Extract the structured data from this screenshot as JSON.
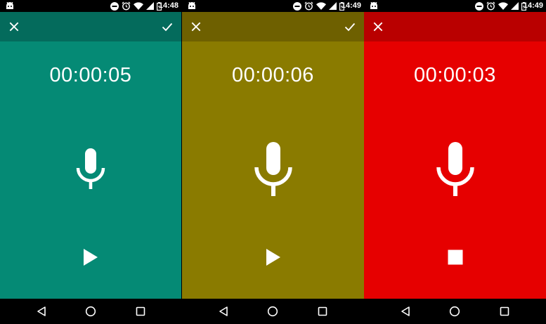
{
  "screens": [
    {
      "time": "14:48",
      "timer": "00:00:05",
      "colors": {
        "toolbar": "#046b5c",
        "body": "#058a75"
      },
      "show_confirm": true,
      "mic_size": "small",
      "control_icon": "play-icon"
    },
    {
      "time": "14:49",
      "timer": "00:00:06",
      "colors": {
        "toolbar": "#6e6000",
        "body": "#8a7b00"
      },
      "show_confirm": true,
      "mic_size": "large",
      "control_icon": "play-icon"
    },
    {
      "time": "14:49",
      "timer": "00:00:03",
      "colors": {
        "toolbar": "#b90000",
        "body": "#e60000"
      },
      "show_confirm": false,
      "mic_size": "large",
      "control_icon": "stop-icon"
    }
  ],
  "icons": {
    "toolbar": [
      "close-icon",
      "check-icon"
    ],
    "status": [
      "android-debug-icon",
      "do-not-disturb-icon",
      "alarm-icon",
      "wifi-icon",
      "cell-signal-icon",
      "battery-icon"
    ],
    "navigation": [
      "back-icon",
      "home-icon",
      "recents-icon"
    ],
    "center": "microphone-icon"
  }
}
